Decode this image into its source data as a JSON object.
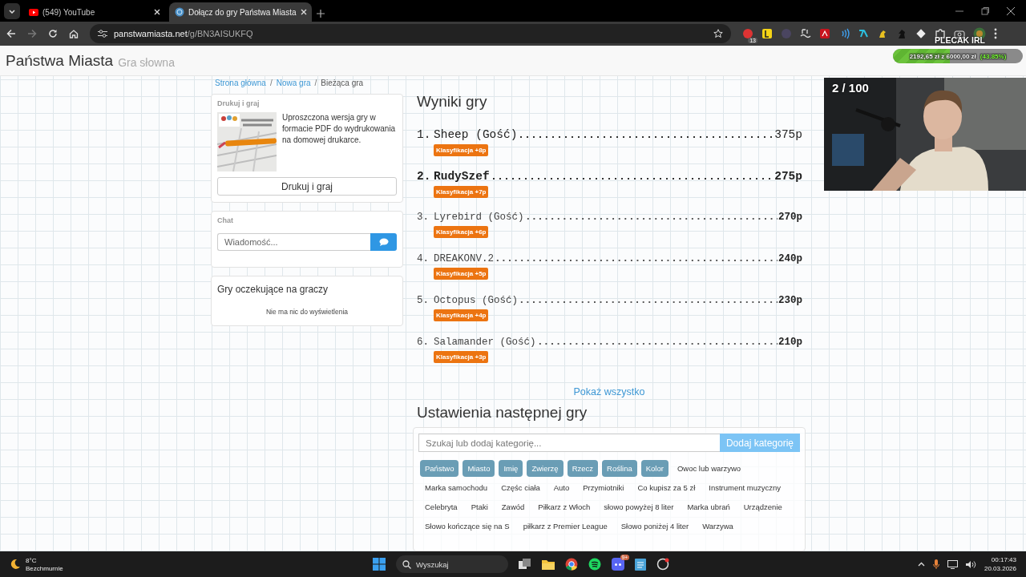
{
  "browser": {
    "tabs": [
      {
        "title": "(549) YouTube",
        "kind": "video",
        "selected": false
      },
      {
        "title": "Dołącz do gry Państwa Miasta",
        "kind": "site",
        "selected": true
      }
    ],
    "url_host": "panstwamiasta.net",
    "url_path": "/g/BN3AISUKFQ",
    "extension_badge": "13"
  },
  "site": {
    "title": "Państwa Miasta",
    "subtitle": "Gra słowna"
  },
  "breadcrumbs": [
    {
      "label": "Strona główna",
      "kind": "link",
      "separator": "/"
    },
    {
      "label": "Nowa gra",
      "kind": "link",
      "separator": "/"
    },
    {
      "label": "Bieżąca gra",
      "kind": "current"
    }
  ],
  "print_card": {
    "heading": "Drukuj i graj",
    "description": "Uproszczona wersja gry w formacie PDF do wydrukowania na domowej drukarce.",
    "button": "Drukuj i graj"
  },
  "chat": {
    "heading": "Chat",
    "placeholder": "Wiadomość..."
  },
  "waiting": {
    "heading": "Gry oczekujące na graczy",
    "empty": "Nie ma nic do wyświetlenia"
  },
  "results": {
    "title": "Wyniki gry",
    "rows": [
      {
        "rank": "1.",
        "name": "Sheep (Gość)",
        "score": "375p",
        "badge": "Klasyfikacja +8p",
        "kind": "top"
      },
      {
        "rank": "2.",
        "name": "RudySzef",
        "score": "275p",
        "badge": "Klasyfikacja +7p",
        "kind": "self"
      },
      {
        "rank": "3.",
        "name": "Lyrebird (Gość)",
        "score": "270p",
        "badge": "Klasyfikacja +6p",
        "kind": "normal"
      },
      {
        "rank": "4.",
        "name": "DREAKONV.2",
        "score": "240p",
        "badge": "Klasyfikacja +5p",
        "kind": "normal"
      },
      {
        "rank": "5.",
        "name": "Octopus (Gość)",
        "score": "230p",
        "badge": "Klasyfikacja +4p",
        "kind": "normal"
      },
      {
        "rank": "6.",
        "name": "Salamander (Gość)",
        "score": "210p",
        "badge": "Klasyfikacja +3p",
        "kind": "normal"
      }
    ],
    "show_all": "Pokaż wszystko"
  },
  "next_game": {
    "title": "Ustawienia następnej gry",
    "search_placeholder": "Szukaj lub dodaj kategorię...",
    "add_button": "Dodaj kategorię",
    "categories": [
      {
        "label": "Państwo",
        "selected": true
      },
      {
        "label": "Miasto",
        "selected": true
      },
      {
        "label": "Imię",
        "selected": true
      },
      {
        "label": "Zwierzę",
        "selected": true
      },
      {
        "label": "Rzecz",
        "selected": true
      },
      {
        "label": "Roślina",
        "selected": true
      },
      {
        "label": "Kolor",
        "selected": true
      },
      {
        "label": "Owoc lub warzywo",
        "selected": false
      },
      {
        "label": "Marka samochodu",
        "selected": false
      },
      {
        "label": "Częśc ciała",
        "selected": false
      },
      {
        "label": "Auto",
        "selected": false
      },
      {
        "label": "Przymiotniki",
        "selected": false
      },
      {
        "label": "Co kupisz za 5 zł",
        "selected": false
      },
      {
        "label": "Instrument muzyczny",
        "selected": false
      },
      {
        "label": "Celebryta",
        "selected": false
      },
      {
        "label": "Ptaki",
        "selected": false
      },
      {
        "label": "Zawód",
        "selected": false
      },
      {
        "label": "Piłkarz z Włoch",
        "selected": false
      },
      {
        "label": "słowo powyżej 8 liter",
        "selected": false
      },
      {
        "label": "Marka ubrań",
        "selected": false
      },
      {
        "label": "Urządzenie",
        "selected": false
      },
      {
        "label": "Słowo kończące się na S",
        "selected": false
      },
      {
        "label": "piłkarz z Premier League",
        "selected": false
      },
      {
        "label": "Słowo poniżej 4 liter",
        "selected": false
      },
      {
        "label": "Warzywa",
        "selected": false
      }
    ]
  },
  "stream_overlay": {
    "goal_label": "PLECAK IRL",
    "goal_amount": "2192,65 zł z 6000,00 zł",
    "goal_percent": "(43.85%)",
    "level": 0.4385,
    "counter": "2 / 100"
  },
  "taskbar": {
    "weather_temp": "8°C",
    "weather_desc": "Bezchmurnie",
    "search_placeholder": "Wyszukaj",
    "app_badge": "9+",
    "time": "00:17:43",
    "date": "20.03.2026"
  }
}
